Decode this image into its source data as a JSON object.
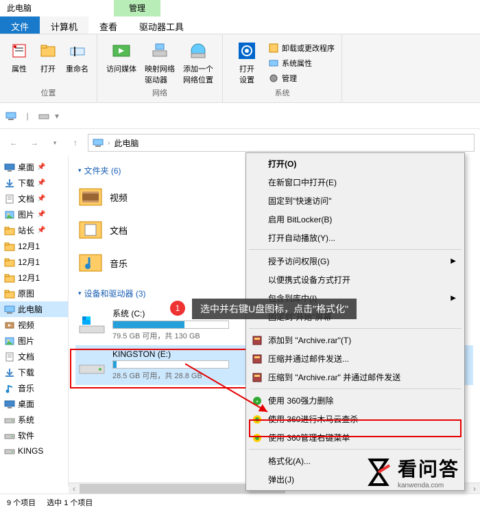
{
  "window": {
    "title": "此电脑",
    "manage_tab": "管理"
  },
  "tabs": {
    "file": "文件",
    "computer": "计算机",
    "view": "查看",
    "drive_tools": "驱动器工具"
  },
  "ribbon": {
    "location_group": "位置",
    "network_group": "网络",
    "system_group": "系统",
    "props": "属性",
    "open": "打开",
    "rename": "重命名",
    "access_media": "访问媒体",
    "map_drive": "映射网络\n驱动器",
    "add_location": "添加一个\n网络位置",
    "open_settings": "打开\n设置",
    "uninstall": "卸载或更改程序",
    "sys_props": "系统属性",
    "manage": "管理"
  },
  "address": {
    "path": "此电脑"
  },
  "sidebar": [
    {
      "icon": "desktop",
      "label": "桌面",
      "pin": true
    },
    {
      "icon": "download",
      "label": "下载",
      "pin": true
    },
    {
      "icon": "doc",
      "label": "文档",
      "pin": true
    },
    {
      "icon": "picture",
      "label": "图片",
      "pin": true
    },
    {
      "icon": "folder",
      "label": "站长",
      "pin": true
    },
    {
      "icon": "folder",
      "label": "12月1",
      "pin": false
    },
    {
      "icon": "folder",
      "label": "12月1",
      "pin": false
    },
    {
      "icon": "folder",
      "label": "12月1",
      "pin": false
    },
    {
      "icon": "folder",
      "label": "原图",
      "pin": false
    },
    {
      "icon": "pc",
      "label": "此电脑",
      "pin": false,
      "selected": true
    },
    {
      "icon": "video",
      "label": "视频",
      "pin": false
    },
    {
      "icon": "picture",
      "label": "图片",
      "pin": false
    },
    {
      "icon": "doc",
      "label": "文档",
      "pin": false
    },
    {
      "icon": "download",
      "label": "下载",
      "pin": false
    },
    {
      "icon": "music",
      "label": "音乐",
      "pin": false
    },
    {
      "icon": "desktop",
      "label": "桌面",
      "pin": false
    },
    {
      "icon": "drive",
      "label": "系统",
      "pin": false
    },
    {
      "icon": "drive",
      "label": "软件",
      "pin": false
    },
    {
      "icon": "drive",
      "label": "KINGS",
      "pin": false
    }
  ],
  "content": {
    "folders_header": "文件夹 (6)",
    "folders": [
      {
        "name": "视频",
        "icon": "video"
      },
      {
        "name": "文档",
        "icon": "doc"
      },
      {
        "name": "音乐",
        "icon": "music"
      }
    ],
    "drives_header": "设备和驱动器 (3)",
    "drives": [
      {
        "name": "系统 (C:)",
        "used_pct": 62,
        "free_text": "79.5 GB 可用，共 130 GB",
        "selected": false,
        "win": true
      },
      {
        "name": "KINGSTON (E:)",
        "used_pct": 3,
        "free_text": "28.5 GB 可用，共 28.8 GB",
        "selected": true,
        "win": false
      }
    ]
  },
  "context_menu": {
    "items": [
      {
        "label": "打开(O)",
        "bold": true
      },
      {
        "label": "在新窗口中打开(E)"
      },
      {
        "label": "固定到\"快速访问\""
      },
      {
        "label": "启用 BitLocker(B)"
      },
      {
        "label": "打开自动播放(Y)..."
      },
      {
        "sep": true
      },
      {
        "label": "授予访问权限(G)",
        "arrow": true
      },
      {
        "label": "以便携式设备方式打开"
      },
      {
        "label": "包含到库中(I)",
        "arrow": true
      },
      {
        "label": "固定到\"开始\"屏幕"
      },
      {
        "sep": true,
        "overlay": true
      },
      {
        "label": "添加到 \"Archive.rar\"(T)",
        "icon": "rar"
      },
      {
        "label": "压缩并通过邮件发送...",
        "icon": "rar"
      },
      {
        "label": "压缩到 \"Archive.rar\" 并通过邮件发送",
        "icon": "rar"
      },
      {
        "sep": true
      },
      {
        "label": "使用 360强力删除",
        "icon": "360"
      },
      {
        "label": "使用 360进行木马云查杀",
        "icon": "360y"
      },
      {
        "label": "使用 360管理右键菜单",
        "icon": "360y"
      },
      {
        "sep": true
      },
      {
        "label": "格式化(A)...",
        "highlight": true
      },
      {
        "label": "弹出(J)"
      }
    ]
  },
  "callout": {
    "num": "1",
    "text": "选中并右键U盘图标，点击\"格式化\""
  },
  "status": {
    "items": "9 个项目",
    "selected": "选中 1 个项目"
  },
  "watermark": {
    "text": "看问答",
    "sub": "kanwenda.com"
  }
}
